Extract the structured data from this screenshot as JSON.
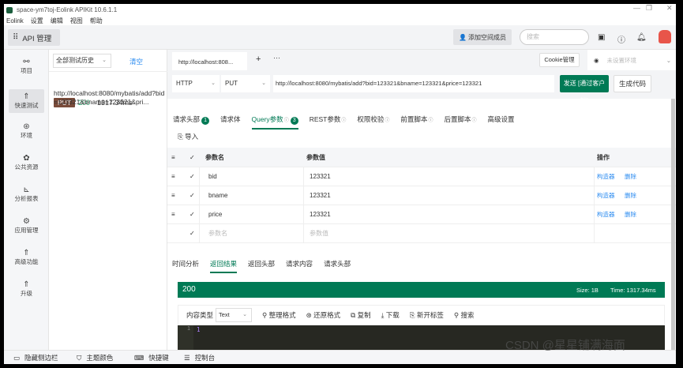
{
  "window": {
    "title": "space-ym7toj-Eolink APIKit 10.6.1.1",
    "controls": [
      "minimize-icon",
      "restore-icon",
      "close-icon"
    ]
  },
  "menu": [
    "Eolink",
    "设置",
    "编辑",
    "视图",
    "帮助"
  ],
  "header": {
    "api_manage": "API 管理",
    "add_member": "添加空间成员",
    "search_placeholder": "搜索"
  },
  "sidebar": {
    "items": [
      {
        "label": "项目",
        "icon": "project-icon"
      },
      {
        "label": "快速测试",
        "icon": "rocket-icon",
        "active": true
      },
      {
        "label": "环境",
        "icon": "environment-icon"
      },
      {
        "label": "公共资源",
        "icon": "puzzle-icon"
      },
      {
        "label": "分析报表",
        "icon": "chart-icon"
      },
      {
        "label": "应用管理",
        "icon": "gear-icon"
      },
      {
        "label": "高级功能",
        "icon": "rocket-icon"
      },
      {
        "label": "升级",
        "icon": "rocket-icon"
      }
    ]
  },
  "history": {
    "filter": "全部测试历史",
    "clear": "清空",
    "items": [
      {
        "method": "PUT",
        "status": "200",
        "time": "1317.34ms",
        "url": "http://localhost:8080/mybatis/add?bid=123321&bname=123321&pri..."
      }
    ]
  },
  "request": {
    "tab_label": "http://localhost:808...",
    "cookie": "Cookie管理",
    "env": "未设置环境",
    "protocol": "HTTP",
    "method": "PUT",
    "url": "http://localhost:8080/mybatis/add?bid=123321&bname=123321&price=123321",
    "send": "发送 [通过客户端]",
    "gen_code": "生成代码",
    "tabs": [
      {
        "label": "请求头部",
        "badge": "1"
      },
      {
        "label": "请求体"
      },
      {
        "label": "Query参数",
        "badge": "3",
        "active": true
      },
      {
        "label": "REST参数"
      },
      {
        "label": "权限校验"
      },
      {
        "label": "前置脚本"
      },
      {
        "label": "后置脚本"
      },
      {
        "label": "高级设置"
      }
    ],
    "import": "导入",
    "table": {
      "headers": {
        "name": "参数名",
        "value": "参数值",
        "ops": "操作"
      },
      "rows": [
        {
          "name": "bid",
          "value": "123321",
          "builder": "构造器",
          "delete": "删除"
        },
        {
          "name": "bname",
          "value": "123321",
          "builder": "构造器",
          "delete": "删除"
        },
        {
          "name": "price",
          "value": "123321",
          "builder": "构造器",
          "delete": "删除"
        }
      ],
      "placeholder": {
        "name": "参数名",
        "value": "参数值"
      }
    }
  },
  "response": {
    "tabs": [
      "时间分析",
      "返回结果",
      "返回头部",
      "请求内容",
      "请求头部"
    ],
    "active_tab": "返回结果",
    "status": "200",
    "size": "Size: 1B",
    "time": "Time: 1317.34ms",
    "content_type_label": "内容类型",
    "content_type": "Text",
    "tools": [
      "整理格式",
      "还原格式",
      "复制",
      "下载",
      "新开标签",
      "搜索"
    ],
    "code": {
      "line": "1",
      "text": "1"
    }
  },
  "bottom": [
    "隐藏侧边栏",
    "主题颜色",
    "快捷键",
    "控制台"
  ],
  "watermark": "CSDN @星星铺满海面",
  "colors": {
    "primary": "#007a55",
    "link": "#2d8cf0",
    "put": "#7a4b3a"
  }
}
